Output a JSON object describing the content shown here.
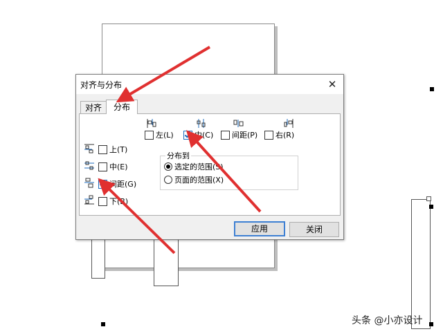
{
  "dialog": {
    "title": "对齐与分布",
    "close_glyph": "✕",
    "tabs": [
      {
        "label": "对齐"
      },
      {
        "label": "分布"
      }
    ],
    "horizontal": [
      {
        "label": "左(L)",
        "checked": false,
        "icon": "distribute-left-icon"
      },
      {
        "label": "中(C)",
        "checked": true,
        "icon": "distribute-center-h-icon"
      },
      {
        "label": "间距(P)",
        "checked": false,
        "icon": "distribute-spacing-h-icon"
      },
      {
        "label": "右(R)",
        "checked": false,
        "icon": "distribute-right-icon"
      }
    ],
    "vertical": [
      {
        "label": "上(T)",
        "checked": false,
        "icon": "distribute-top-icon"
      },
      {
        "label": "中(E)",
        "checked": false,
        "icon": "distribute-center-v-icon"
      },
      {
        "label": "间距(G)",
        "checked": true,
        "icon": "distribute-spacing-v-icon"
      },
      {
        "label": "下(B)",
        "checked": false,
        "icon": "distribute-bottom-icon"
      }
    ],
    "distribute_to": {
      "title": "分布到",
      "options": [
        {
          "label": "选定的范围(S)",
          "selected": true
        },
        {
          "label": "页面的范围(X)",
          "selected": false
        }
      ]
    },
    "buttons": {
      "apply": "应用",
      "close": "关闭"
    }
  },
  "watermark": "头条 @小亦设计",
  "colors": {
    "annotation_arrow": "#e03030",
    "focus_border": "#3d7fd3",
    "check_blue": "#1d6bbd"
  }
}
